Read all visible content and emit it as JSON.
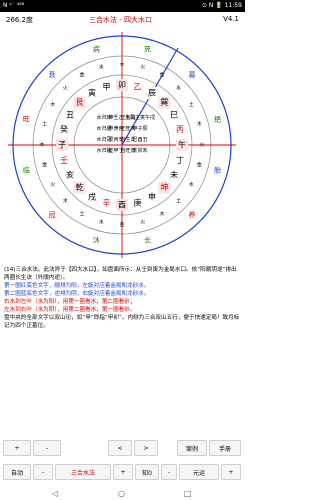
{
  "status": {
    "left": "N ᵒ˙ ⁴⁶⁸",
    "right": "⊙ N 🔋 11:59"
  },
  "header": {
    "degree": "266.2度",
    "title": "三合水法 - 四大水口",
    "version": "V4.1"
  },
  "compass": {
    "outer_ring": [
      "死",
      "墓",
      "绝",
      "胎",
      "养",
      "长",
      "沐",
      "冠",
      "临",
      "旺",
      "衰",
      "病"
    ],
    "outer_left_right": {
      "left_top": "衰",
      "left_mid": "旺",
      "left_low": "沐",
      "right_top": "养",
      "right_mid": "长",
      "right_low": "冠"
    },
    "mountains": [
      "卯",
      "乙",
      "辰",
      "巽",
      "巳",
      "丙",
      "午",
      "丁",
      "未",
      "坤",
      "申",
      "庚",
      "酉",
      "辛",
      "戌",
      "乾",
      "亥",
      "壬",
      "子",
      "癸",
      "丑",
      "艮",
      "寅",
      "甲"
    ],
    "elements": [
      "木",
      "火",
      "金",
      "水",
      "土"
    ],
    "center_lines": [
      "木局主寅午戌",
      "金局辰申子",
      "火局巳酉丑",
      "水局亥卯未",
      "乾甲丁寅午戌",
      "坤壬乙申子辰",
      "艮丙辛巳酉丑",
      "巽庚癸亥卯未"
    ],
    "center_columns": [
      [
        "木局主寅午戌",
        "申子辰",
        "巳酉丑",
        "亥卯未"
      ],
      [
        "正生向",
        "正旺向",
        "自生向",
        "自旺向"
      ],
      [
        "坤壬乙",
        "甲庚丙",
        "艮丙辛",
        "乾甲丁"
      ],
      [
        "水归库",
        "水归墓",
        "水归冠",
        "水归临"
      ]
    ]
  },
  "description": {
    "line1": "(14)三合水法。此法异于【四大水口】，如盘面所示：从壬到寅为金局水口。依“阳顺阴逆”排出两圈长生诀（外顺内逆）。",
    "line2": "第一圈红底色文字，顺排为阳，左旋对应着金局和龙砂水。",
    "line3": "第二圈蓝底色文字，逆排为阴，右旋对应着金局和龙砂水。",
    "line4": "右水到左叶（水为阳），用第一圈看水，第二圈看砂；",
    "line5": "左水到右叶（水为阴），用第二圈看水，第一圈看砂。",
    "line6": "盘中央的全部文字以双山论，如“甲”即指“甲卯”。内侧为三合双山五行，便于快速定局！致月标记为四个正墓位。"
  },
  "controls": {
    "plus": "+",
    "minus": "-",
    "lt": "<",
    "gt": ">",
    "case": "案例",
    "manual": "手册",
    "auto": "自动",
    "minus2": "-",
    "mode": "三合水法",
    "plus2": "+",
    "zhiying": "知0",
    "fade": "-",
    "yuanyun": "元运",
    "plus3": "+"
  },
  "nav": {
    "back": "◁",
    "home": "○",
    "recent": "□"
  }
}
